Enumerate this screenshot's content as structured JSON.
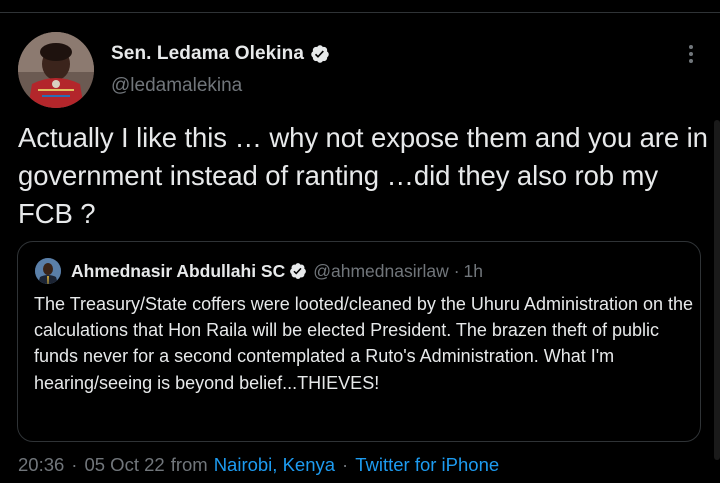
{
  "colors": {
    "background": "#000000",
    "text_primary": "#e7e9ea",
    "text_secondary": "#71767b",
    "link": "#1d9bf0",
    "border": "#2f3336",
    "verified_badge": "#e7e9ea"
  },
  "tweet": {
    "author_name": "Sen. Ledama Olekina",
    "author_handle": "@ledamalekina",
    "verified_icon": "verified-badge-icon",
    "more_icon": "more-options-icon",
    "text": "Actually I like this … why not expose them and you are in government instead of ranting …did they also rob my FCB ?"
  },
  "quoted_tweet": {
    "author_name": "Ahmednasir Abdullahi SC",
    "author_handle": "@ahmednasirlaw",
    "separator": "·",
    "time": "1h",
    "text": "The Treasury/State coffers were looted/cleaned by the Uhuru Administration on the calculations that Hon Raila will be elected President. The brazen theft of public funds never for a second contemplated a Ruto's Administration. What I'm hearing/seeing is beyond belief...THIEVES!"
  },
  "meta": {
    "timestamp": "20:36",
    "dot1": "·",
    "date": "05 Oct 22",
    "from_label": "from",
    "location": "Nairobi, Kenya",
    "dot2": "·",
    "source": "Twitter for iPhone"
  }
}
